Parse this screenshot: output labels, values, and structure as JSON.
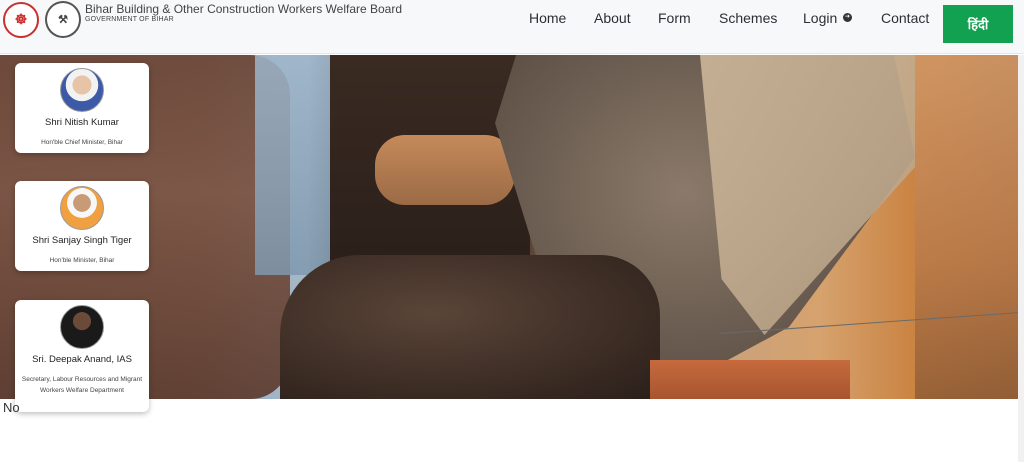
{
  "header": {
    "logos": [
      "bihar-emblem-icon",
      "board-logo-icon"
    ],
    "title": "Bihar Building & Other Construction Workers Welfare Board",
    "subtitle": "GOVERNMENT OF BIHAR"
  },
  "nav": {
    "items": [
      {
        "label": "Home"
      },
      {
        "label": "About"
      },
      {
        "label": "Form"
      },
      {
        "label": "Schemes"
      },
      {
        "label": "Login",
        "icon": "arrow-circle-icon"
      },
      {
        "label": "Contact"
      }
    ],
    "language_button": "हिंदी"
  },
  "hero": {
    "image": "worker-hand-trowel-photo"
  },
  "profiles": [
    {
      "name": "Shri Nitish Kumar",
      "role": "Hon'ble Chief Minister, Bihar"
    },
    {
      "name": "Shri Sanjay Singh Tiger",
      "role": "Hon'ble Minister, Bihar"
    },
    {
      "name": "Sri. Deepak Anand, IAS",
      "role": "Secretary, Labour Resources and Migrant Workers Welfare Department"
    }
  ],
  "notice_fragment": "No",
  "colors": {
    "accent_green": "#12a150",
    "header_bg": "#f7f8fa",
    "emblem_red": "#c8302f"
  }
}
